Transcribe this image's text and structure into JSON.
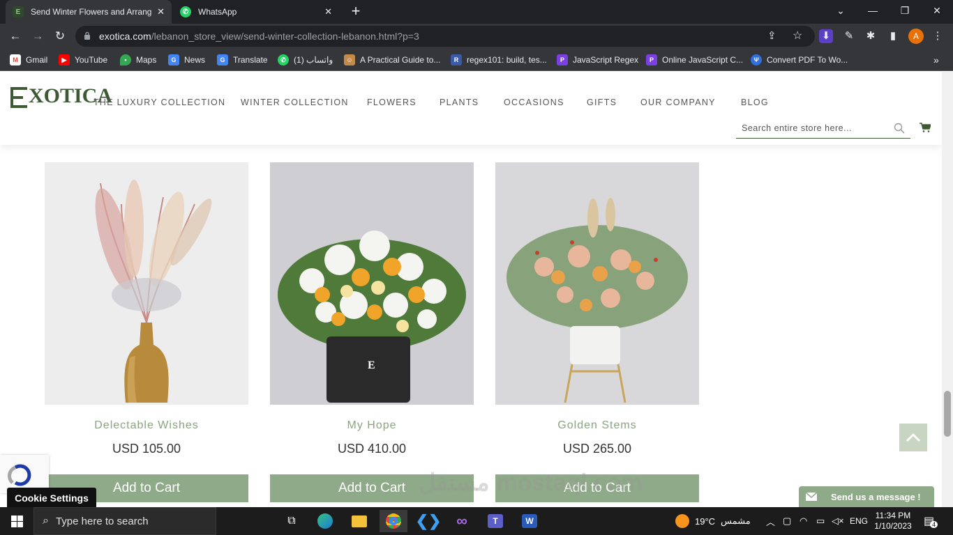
{
  "browser": {
    "tabs": [
      {
        "title": "Send Winter Flowers and Arrange",
        "active": true
      },
      {
        "title": "WhatsApp",
        "active": false
      }
    ],
    "url_domain": "exotica.com",
    "url_path": "/lebanon_store_view/send-winter-collection-lebanon.html?p=3",
    "profile_initial": "A",
    "bookmarks": [
      {
        "label": "Gmail",
        "icon": "gmail-icon",
        "color": "#ea4335"
      },
      {
        "label": "YouTube",
        "icon": "youtube-icon",
        "color": "#ff0000"
      },
      {
        "label": "Maps",
        "icon": "maps-icon",
        "color": "#34a853"
      },
      {
        "label": "News",
        "icon": "news-icon",
        "color": "#4285f4"
      },
      {
        "label": "Translate",
        "icon": "translate-icon",
        "color": "#4285f4"
      },
      {
        "label": "واتساب (1)",
        "icon": "whatsapp-icon",
        "color": "#25d366"
      },
      {
        "label": "A Practical Guide to...",
        "icon": "guide-icon",
        "color": "#c58a4a"
      },
      {
        "label": "regex101: build, tes...",
        "icon": "regex101-icon",
        "color": "#3b5ba9"
      },
      {
        "label": "JavaScript Regex",
        "icon": "js-regex-icon",
        "color": "#7b3fe4"
      },
      {
        "label": "Online JavaScript C...",
        "icon": "js-compiler-icon",
        "color": "#7b3fe4"
      },
      {
        "label": "Convert PDF To Wo...",
        "icon": "pdf-convert-icon",
        "color": "#2f6fde"
      }
    ]
  },
  "site": {
    "logo": "XOTICA",
    "nav": [
      "THE LUXURY COLLECTION",
      "WINTER COLLECTION",
      "FLOWERS",
      "PLANTS",
      "OCCASIONS",
      "GIFTS",
      "OUR COMPANY",
      "BLOG"
    ],
    "search_placeholder": "Search entire store here...",
    "colors": {
      "brand": "#3d5a35",
      "button": "#8faa89",
      "product_name": "#8aa481"
    }
  },
  "products": [
    {
      "name": "Delectable Wishes",
      "price": "USD 105.00",
      "cta": "Add to Cart"
    },
    {
      "name": "My Hope",
      "price": "USD 410.00",
      "cta": "Add to Cart"
    },
    {
      "name": "Golden Stems",
      "price": "USD 265.00",
      "cta": "Add to Cart"
    }
  ],
  "widgets": {
    "cookie_settings": "Cookie Settings",
    "send_message": "Send us a message !",
    "watermark": "مستقل mostaql.com"
  },
  "taskbar": {
    "search_placeholder": "Type here to search",
    "weather": "19°C",
    "weather_label": "مشمس",
    "language": "ENG",
    "time": "11:34 PM",
    "date": "1/10/2023",
    "notifications": "4"
  }
}
